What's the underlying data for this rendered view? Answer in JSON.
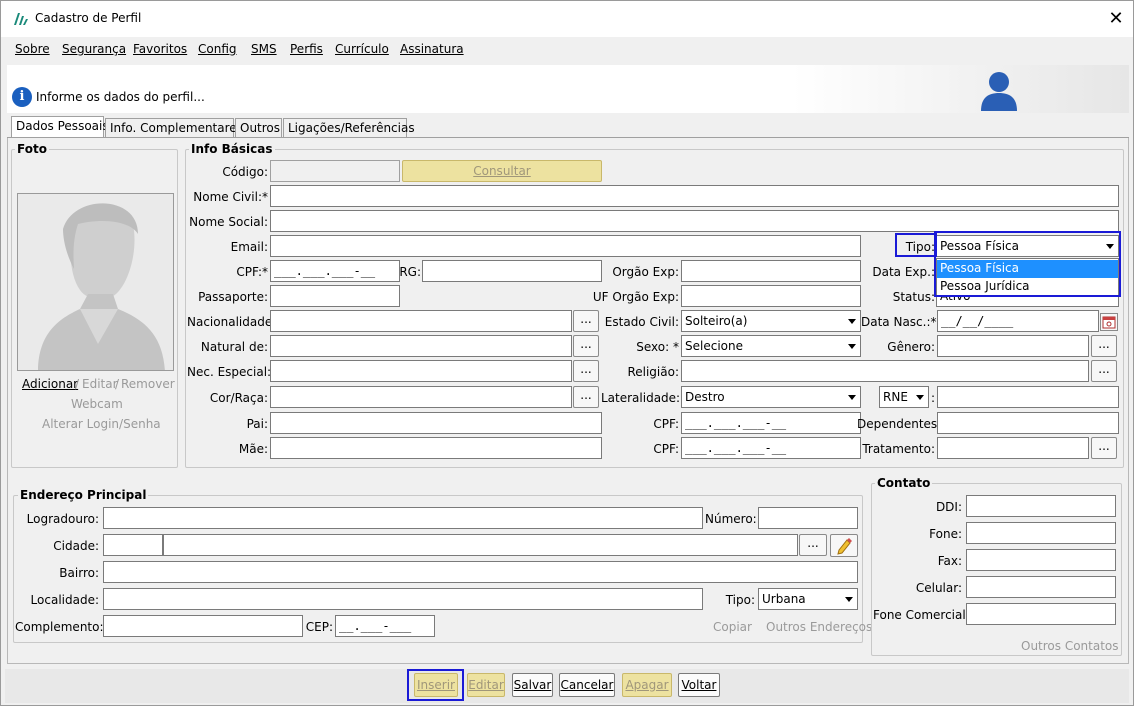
{
  "window": {
    "title": "Cadastro de Perfil",
    "close_glyph": "✕"
  },
  "menu": [
    "Sobre",
    "Segurança",
    "Favoritos",
    "Config",
    "SMS",
    "Perfis",
    "Currículo",
    "Assinatura"
  ],
  "info": {
    "icon_glyph": "i",
    "text": "Informe os dados do perfil..."
  },
  "tabs": [
    "Dados Pessoais",
    "Info. Complementares",
    "Outros",
    "Ligações/Referências"
  ],
  "foto": {
    "legend": "Foto",
    "adicionar": "Adicionar",
    "sep1": "/",
    "editar": "Editar",
    "sep2": "/",
    "remover": "Remover",
    "webcam": "Webcam",
    "alterar_login": "Alterar Login/Senha"
  },
  "info_basicas": {
    "legend": "Info Básicas",
    "codigo_label": "Código:",
    "consultar": "Consultar",
    "nome_civil_label": "Nome Civil:*",
    "nome_social_label": "Nome Social:",
    "email_label": "Email:",
    "tipo_label": "Tipo:",
    "tipo_value": "Pessoa Física",
    "tipo_options": [
      "Pessoa Física",
      "Pessoa Jurídica"
    ],
    "cpf_label": "CPF:*",
    "cpf_mask": "___.___.___-__",
    "rg_label": "RG:",
    "orgao_exp_label": "Orgão Exp:",
    "data_exp_label": "Data Exp.:",
    "passaporte_label": "Passaporte:",
    "uf_orgao_label": "UF Orgão Exp:",
    "status_label": "Status:",
    "status_value": "Ativo",
    "nacionalidade_label": "Nacionalidade:",
    "estado_civil_label": "Estado Civil:",
    "estado_civil_value": "Solteiro(a)",
    "data_nasc_label": "Data Nasc.:*",
    "data_nasc_mask": "__/__/____",
    "natural_label": "Natural de:",
    "sexo_label": "Sexo: *",
    "sexo_value": "Selecione",
    "genero_label": "Gênero:",
    "nec_especial_label": "Nec. Especial:",
    "religiao_label": "Religião:",
    "cor_raca_label": "Cor/Raça:",
    "lateralidade_label": "Lateralidade:",
    "lateralidade_value": "Destro",
    "rne_value": "RNE",
    "rne_colon": ":",
    "pai_label": "Pai:",
    "cpf_pai_label": "CPF:",
    "cpf_pai_mask": "___.___.___-__",
    "dependentes_label": "Dependentes:",
    "mae_label": "Mãe:",
    "cpf_mae_label": "CPF:",
    "cpf_mae_mask": "___.___.___-__",
    "tratamento_label": "Tratamento:",
    "dots": "..."
  },
  "endereco": {
    "legend": "Endereço Principal",
    "logradouro_label": "Logradouro:",
    "numero_label": "Número:",
    "cidade_label": "Cidade:",
    "bairro_label": "Bairro:",
    "localidade_label": "Localidade:",
    "tipo_label": "Tipo:",
    "tipo_value": "Urbana",
    "complemento_label": "Complemento:",
    "cep_label": "CEP:",
    "cep_mask": "__.___-___",
    "copiar": "Copiar",
    "outros_enderecos": "Outros Endereços"
  },
  "contato": {
    "legend": "Contato",
    "ddi_label": "DDI:",
    "fone_label": "Fone:",
    "fax_label": "Fax:",
    "celular_label": "Celular:",
    "fone_comercial_label": "Fone Comercial:",
    "outros_contatos": "Outros Contatos"
  },
  "actions": {
    "inserir": "Inserir",
    "editar": "Editar",
    "salvar": "Salvar",
    "cancelar": "Cancelar",
    "apagar": "Apagar",
    "voltar": "Voltar"
  },
  "colors": {
    "highlight": "#1a1ad6",
    "selection": "#1e90ff",
    "disabled_button": "#ede2a0"
  }
}
